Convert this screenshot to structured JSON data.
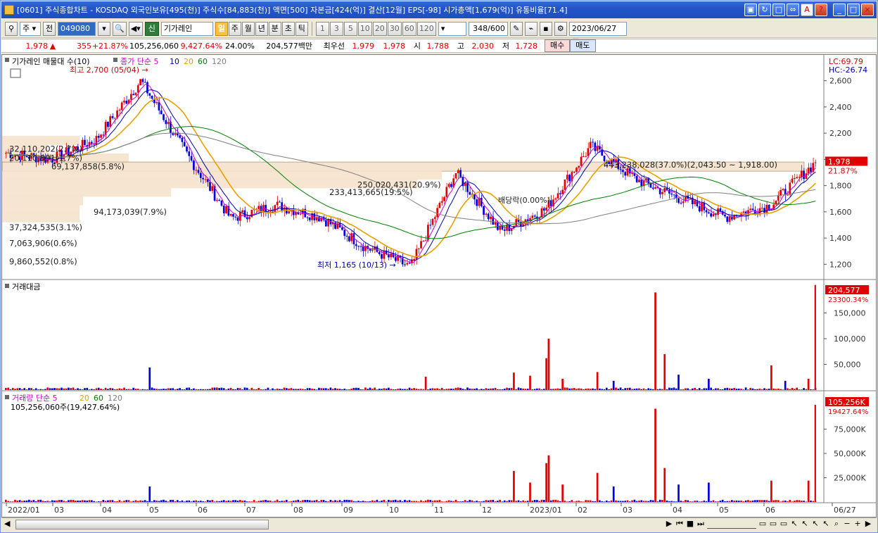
{
  "window": {
    "title": "[0601] 주식종합차트 - KOSDAQ 외국인보유[495(천)] 주식수[84,883(천)] 액면[500] 자본금[424(억)] 결산[12월] EPS[-98] 시가총액[1,679(억)] 유통비율[71.4]",
    "buttons": [
      "⇔",
      "?"
    ]
  },
  "toolbar": {
    "period_select": "주",
    "prev_label": "전",
    "stock_code": "049080",
    "stock_name": "기가레인",
    "stock_badge": "신",
    "period_buttons": [
      "일",
      "주",
      "월",
      "년",
      "분",
      "초",
      "틱"
    ],
    "selected_period": "일",
    "minute_buttons": [
      "1",
      "3",
      "5",
      "10",
      "20",
      "30",
      "60",
      "120"
    ],
    "count_value": "348",
    "count_max": "/600",
    "date_value": "2023/06/27"
  },
  "quote": {
    "price": "1,978",
    "arrow": "▲",
    "change": "355",
    "change_pct": "+21.87%",
    "volume": "105,256,060",
    "volume_ratio": "9,427.64%",
    "turnover": "24.00%",
    "amount": "204,577백만",
    "best_label": "최우선",
    "bid": "1,979",
    "ask": "1,978",
    "open_label": "시",
    "open": "1,788",
    "high_label": "고",
    "high": "2,030",
    "low_label": "저",
    "low": "1,728",
    "buy_label": "매수",
    "sell_label": "매도"
  },
  "price_panel": {
    "legend_main": "기가레인 매물대 수(10)",
    "legend_ma": "종가 단순 5",
    "ma_periods": [
      "10",
      "20",
      "60",
      "120"
    ],
    "lc_label": "LC:69.79",
    "hc_label": "HC:-26.74",
    "current_price_tag": "1,978",
    "current_pct_tag": "21.87%",
    "high_annotation": "최고 2,700 (05/04) →",
    "low_annotation": "최저 1,165 (10/13) →",
    "dividend_annotation": "배당락(0.00%)",
    "y_ticks": [
      "2,600",
      "2,400",
      "2,200",
      "2,000",
      "1,800",
      "1,600",
      "1,400",
      "1,200"
    ],
    "volume_profile_labels": [
      "32,110,202(2.7%)",
      "20,110,891(1.7%)",
      "69,137,858(5.8%)",
      "443,238,028(37.0%)(2,043.50 ~ 1,918.00)",
      "250,020,431(20.9%)",
      "233,413,665(19.5%)",
      "94,173,039(7.9%)",
      "37,324,535(3.1%)",
      "7,063,906(0.6%)",
      "9,860,552(0.8%)"
    ]
  },
  "amount_panel": {
    "legend": "거래대금",
    "y_ticks": [
      "150,000",
      "100,000",
      "50,000"
    ],
    "current_tag": "204,577",
    "current_sub": "23300.34%"
  },
  "volume_panel": {
    "legend": "거래량 단순 5",
    "ma_periods": [
      "20",
      "60",
      "120"
    ],
    "current_text": "105,256,060주(19,427.64%)",
    "y_ticks": [
      "75,000K",
      "50,000K",
      "25,000K"
    ],
    "current_tag": "105,256K",
    "current_sub": "19427.64%"
  },
  "x_axis": {
    "labels": [
      "2022/01",
      "03",
      "04",
      "05",
      "06",
      "07",
      "08",
      "09",
      "10",
      "11",
      "12",
      "2023/01",
      "02",
      "03",
      "04",
      "05",
      "06",
      "06/27"
    ]
  },
  "colors": {
    "up": "#e00000",
    "down": "#0000dd",
    "ma5": "#cc00cc",
    "ma10": "#0000aa",
    "ma20": "#e8a000",
    "ma60": "#008000",
    "ma120": "#808080",
    "profile": "#f5e2cc"
  },
  "chart_data": {
    "type": "candlestick",
    "title": "기가레인",
    "x": [
      "2022/01",
      "03",
      "04",
      "05",
      "06",
      "07",
      "08",
      "09",
      "10",
      "11",
      "12",
      "2023/01",
      "02",
      "03",
      "04",
      "05",
      "06",
      "06/27"
    ],
    "ylim": [
      1100,
      2700
    ],
    "close_series": {
      "name": "종가",
      "values": [
        2050,
        2000,
        2150,
        2600,
        2050,
        1550,
        1650,
        1560,
        1330,
        1180,
        1900,
        1450,
        1620,
        2100,
        1850,
        1700,
        1560,
        1650,
        1978
      ]
    },
    "ma_series": [
      {
        "name": "5",
        "color": "#cc00cc"
      },
      {
        "name": "10",
        "color": "#0000aa"
      },
      {
        "name": "20",
        "color": "#e8a000"
      },
      {
        "name": "60",
        "color": "#008000"
      },
      {
        "name": "120",
        "color": "#808080"
      }
    ],
    "extremes": {
      "high": 2700,
      "high_date": "05/04",
      "low": 1165,
      "low_date": "10/13"
    },
    "amount_last": 204577,
    "volume_last": 105256060
  }
}
